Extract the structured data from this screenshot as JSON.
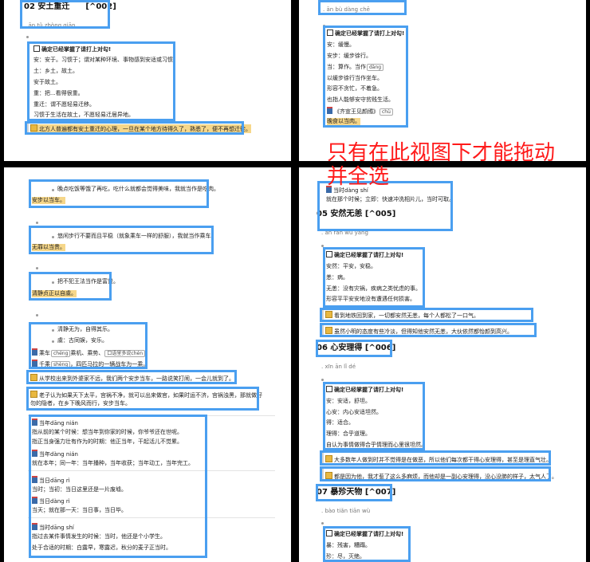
{
  "overlay_text": {
    "line1": "只有在此视图下才能拖动",
    "line2": "并全选"
  },
  "tl": {
    "heading": "02 安土重迁　　[^002]",
    "pinyin": ". ān tǔ zhòng qiān",
    "check_title": "确定已经掌握了请打上对勾!",
    "lines": [
      "安：安于。习惯于；谓对某种环境、事物感到安适或习惯。",
      "土：乡土，故土。",
      "安于故土。",
      "重：把...看得很重。",
      "重迁：谓不愿轻易迁移。",
      "习惯于生活在故土，不愿轻易迁居异地。"
    ],
    "quote": "北方人普遍都有安土重迁的心理，一旦在某个地方待得久了，熟悉了，便不再想迁徙。"
  },
  "tr": {
    "top_pinyin": ". ān bù dàng chē",
    "check_title": "确定已经掌握了请打上对勾!",
    "lines": [
      "安：缓慢。",
      "安步：缓步徐行。",
      "当：算作。当作",
      "以缓步徐行当作坐车。",
      "形容不贪忙，不着急。",
      "也指人能够安守贫贱生活。",
      "《齐宣王见颜斶》",
      "晚食以当肉。"
    ],
    "tags": {
      "dang": "dàng",
      "chu": "chù"
    }
  },
  "bl": {
    "b1": "晚点吃饭等饿了再吃，吃什么就都会觉得美味，我就当作是吃肉。",
    "b1h": "安步以当车。",
    "b2": "悠闲步行不要而且平稳（就象乘车一样的舒服），我就当作乘车。",
    "b2h": "无罪以当贵。",
    "b3": "把不犯王法当作是富贵。",
    "b3h": "清静贞正以自虞。",
    "b4a": "清静无为，自得其乐。",
    "b4b": "虞：古同娱，安乐。",
    "w1": "乘车",
    "w1tag": "chéng",
    "w1b": "乘机、乘势、",
    "w1c": "口语里多说chén",
    "w2": "千乘",
    "w2tag": "shèng",
    "w2b": "，四匹马拉的一辆战车为一乘。",
    "q1": "从学校出来到外婆家不远，我们两个安步当车，一路说笑打闹，一会儿就到了。",
    "q2a": "老子认为如果天下太平，宫祸不净，就可以出来做官，如果时运不济，宫祸浊黑，那就做好",
    "q2b": "勿的隐者，在乡下晚风而行，安步当车。",
    "words": [
      {
        "w": "当年",
        "p": "dāng nián",
        "defs": [
          "指从前的某个时候：想当年到你家的时候，你爷爷还在世呢。",
          "指正当身强力壮有作为的时期：他正当年，干起活儿不觉累。"
        ]
      },
      {
        "w": "当年",
        "p": "dàng nián",
        "defs": [
          "就在本年；同一年：当年播种，当年收获；当年动工，当年完工。"
        ]
      },
      {
        "w": "当日",
        "p": "dāng rì",
        "defs": [
          "当时；当初：当日这里还是一片废墟。"
        ]
      },
      {
        "w": "当日",
        "p": "dàng rì",
        "defs": [
          "当天；就在那一天：当日事，当日毕。"
        ]
      },
      {
        "w": "当时",
        "p": "dāng shí",
        "defs": [
          "指过去某件事情发生的时候：当时，他还是个小学生。",
          "处于合适的时期：白露早，寒露迟，秋分的麦子正当时。"
        ]
      }
    ]
  },
  "br": {
    "t1": "当时dàng shí",
    "t2": "就在那个时候；立即：快速冲洗相片儿，当时可取。",
    "h1": "05 安然无恙 [^005]",
    "p1": ". ān rán wú yàng",
    "check_title": "确定已经掌握了请打上对勾!",
    "lines1": [
      "安然：平安，安稳。",
      "恙：病。",
      "无恙：没有灾祸，疾病之类忧虑的事。",
      "形容平平安安地没有遭遇任何损害。"
    ],
    "q1": "看到地铁回到家，一切都安然无恙，每个人都松了一口气。",
    "q2": "虽然小明的态度有些冷淡，但得知他安然无恙，大伙依然都怡颜到高兴。",
    "h2": "06 心安理得 [^006]",
    "p2": ". xīn ān lǐ dé",
    "lines2": [
      "安：安适，舒坦。",
      "心安：内心安适坦然。",
      "得：适合。",
      "理得：合乎道理。",
      "自认为事情做得合乎情理而心里很坦然。"
    ],
    "q3": "大多数年人做到时并不觉得是在做恶，所以他们每次都干得心安理得，甚至是理直气壮。",
    "q4": "都是因为他，我才惹了这么多麻烦，而他却是一副心安理得，没心没肺的样子，太气人了。",
    "h3": "07 暴殄天物 [^007]",
    "p3": ". bào tiǎn tiān wù",
    "lines3": [
      "暴：残害，糟蹋。",
      "殄：尽，灭绝。"
    ]
  }
}
